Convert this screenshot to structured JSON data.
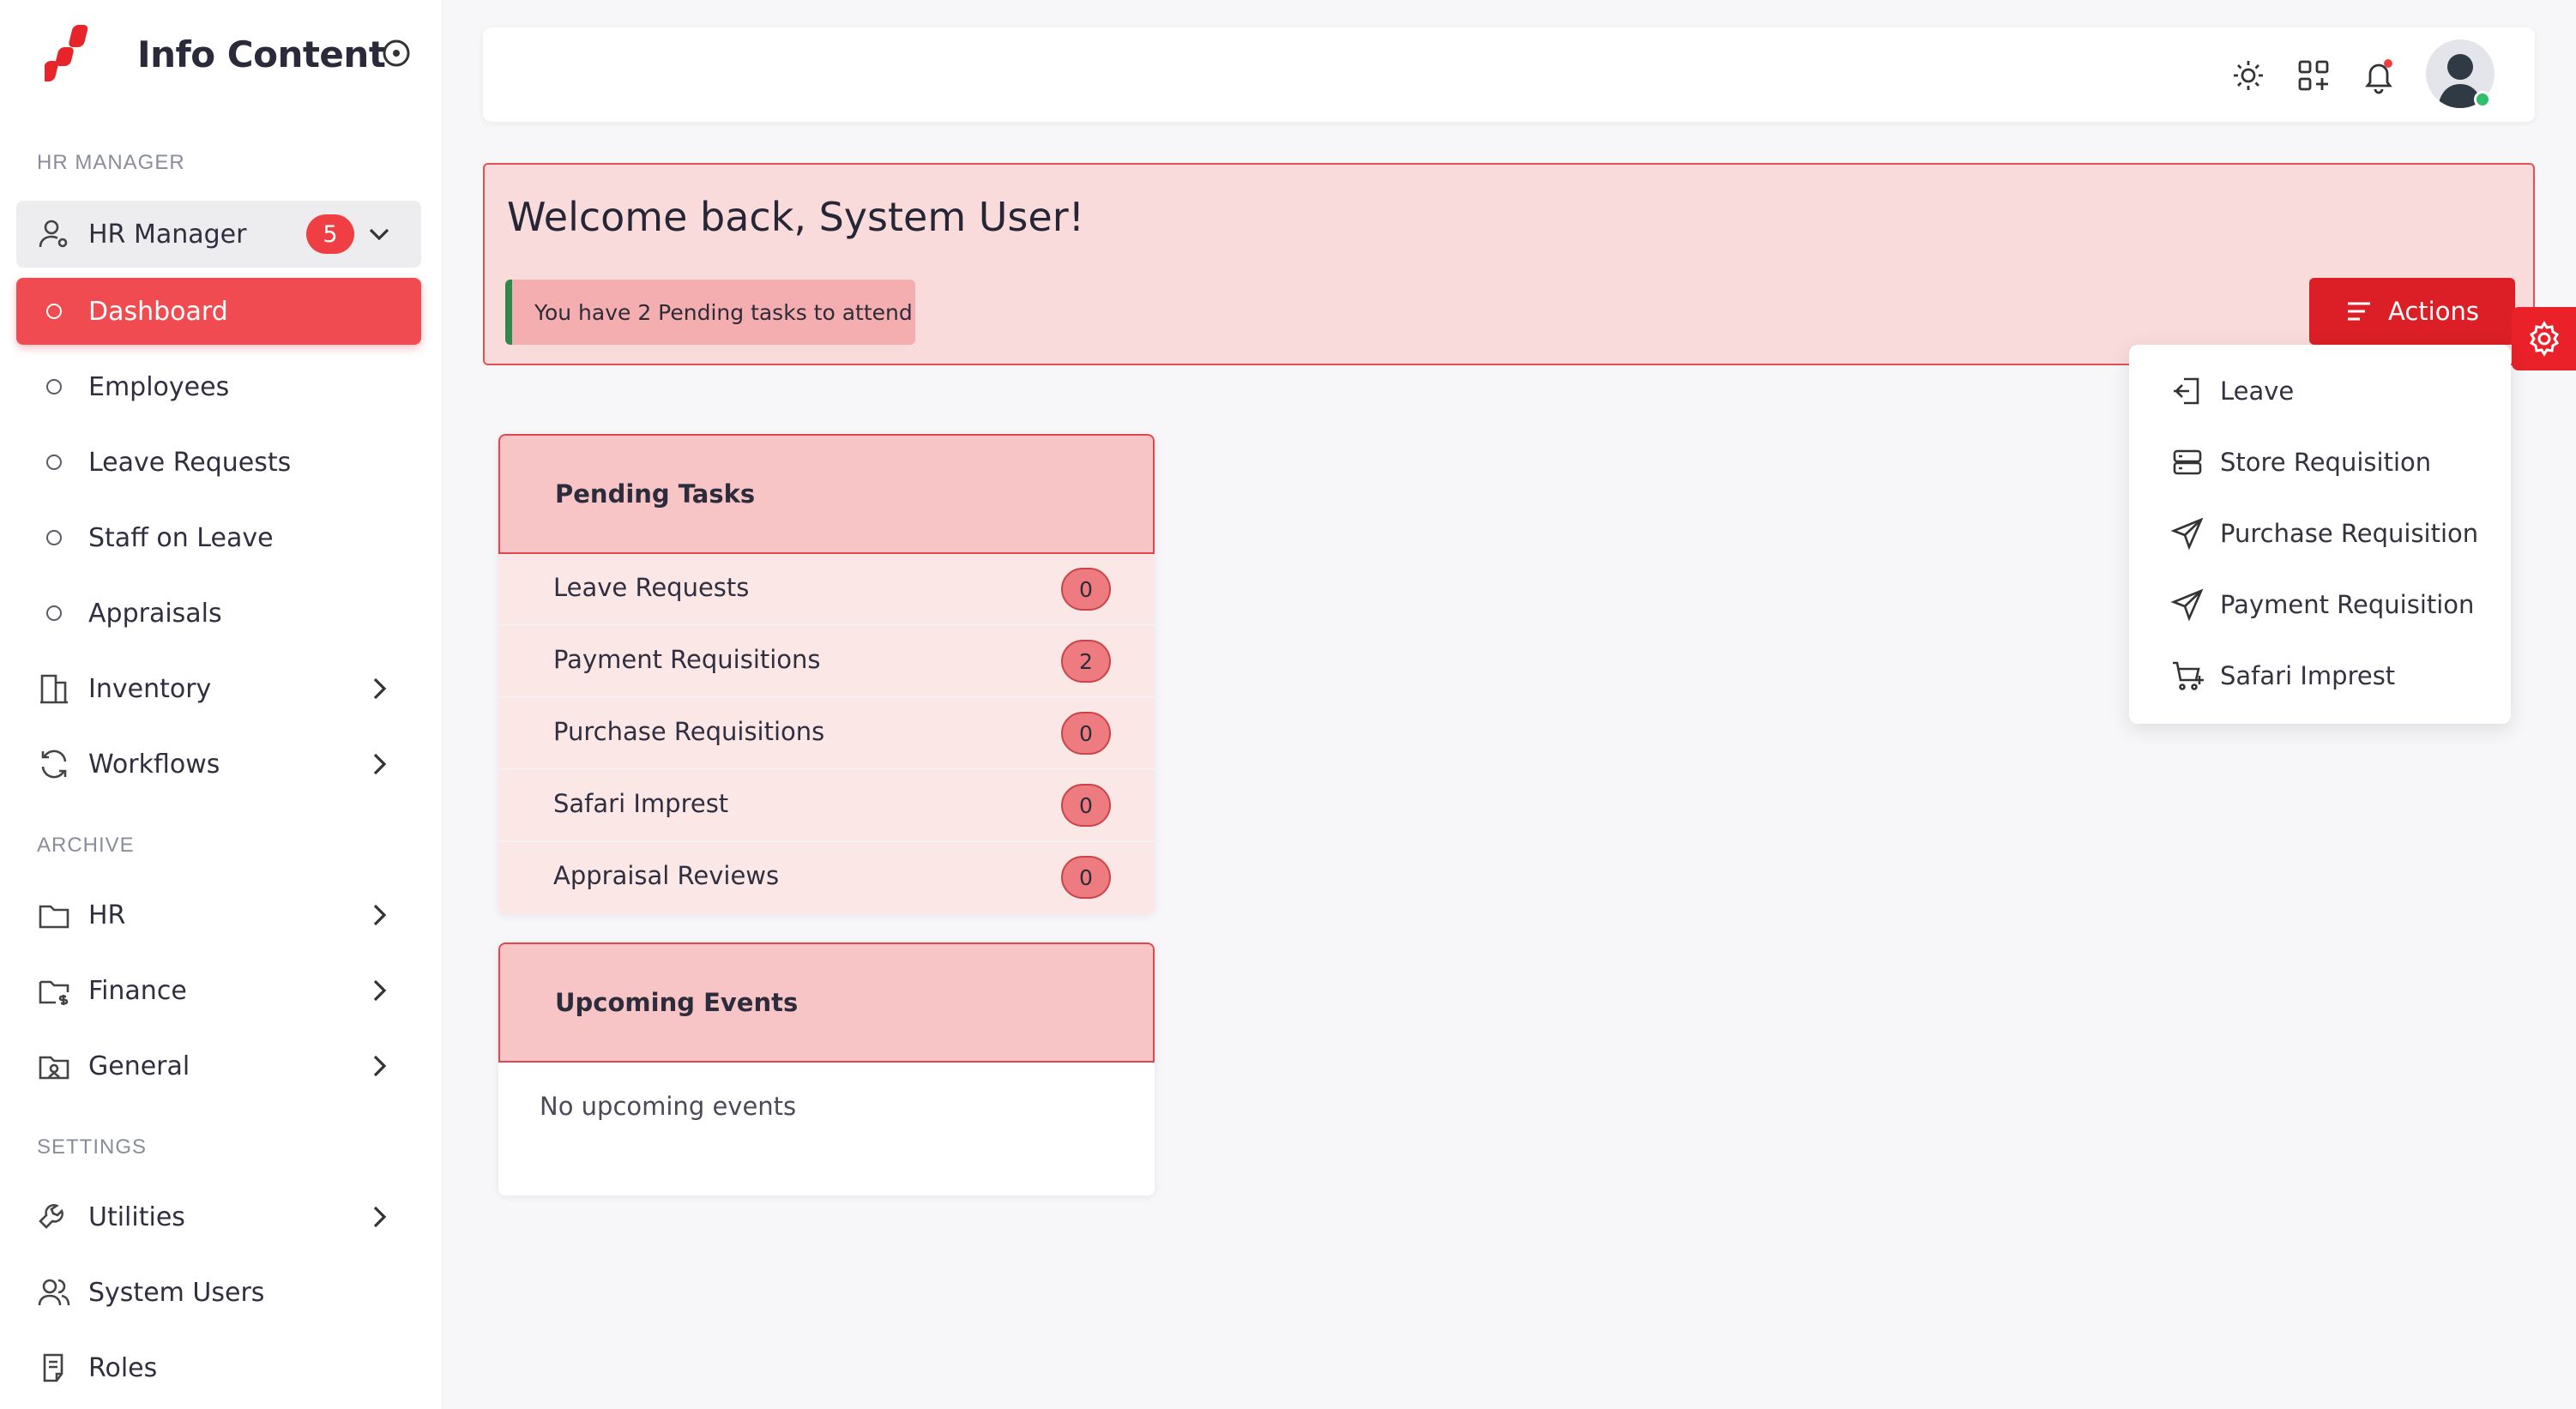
{
  "brand": {
    "title": "Info Content"
  },
  "sidebar": {
    "sections": {
      "hr_manager": "HR MANAGER",
      "archive": "ARCHIVE",
      "settings": "SETTINGS"
    },
    "group": {
      "label": "HR Manager",
      "badge": "5"
    },
    "hr_items": [
      {
        "label": "Dashboard",
        "active": true
      },
      {
        "label": "Employees"
      },
      {
        "label": "Leave Requests"
      },
      {
        "label": "Staff on Leave"
      },
      {
        "label": "Appraisals"
      }
    ],
    "modules": [
      {
        "label": "Inventory",
        "icon": "building-icon"
      },
      {
        "label": "Workflows",
        "icon": "refresh-icon"
      }
    ],
    "archive_items": [
      {
        "label": "HR",
        "icon": "folder-icon"
      },
      {
        "label": "Finance",
        "icon": "folder-dollar-icon"
      },
      {
        "label": "General",
        "icon": "folder-image-icon"
      }
    ],
    "settings_items": [
      {
        "label": "Utilities",
        "icon": "wrench-icon"
      },
      {
        "label": "System Users",
        "icon": "users-icon"
      },
      {
        "label": "Roles",
        "icon": "clipboard-icon"
      }
    ]
  },
  "welcome": {
    "title": "Welcome back, System User!",
    "pending_notice": "You have 2 Pending tasks to attend",
    "actions_label": "Actions"
  },
  "actions_menu": [
    {
      "label": "Leave",
      "icon": "sign-in-icon"
    },
    {
      "label": "Store Requisition",
      "icon": "server-icon"
    },
    {
      "label": "Purchase Requisition",
      "icon": "send-icon"
    },
    {
      "label": "Payment Requisition",
      "icon": "send-icon"
    },
    {
      "label": "Safari Imprest",
      "icon": "cart-plus-icon"
    }
  ],
  "pending_tasks": {
    "title": "Pending Tasks",
    "rows": [
      {
        "label": "Leave Requests",
        "count": "0"
      },
      {
        "label": "Payment Requisitions",
        "count": "2"
      },
      {
        "label": "Purchase Requisitions",
        "count": "0"
      },
      {
        "label": "Safari Imprest",
        "count": "0"
      },
      {
        "label": "Appraisal Reviews",
        "count": "0"
      }
    ]
  },
  "upcoming_events": {
    "title": "Upcoming Events",
    "empty": "No upcoming events"
  },
  "colors": {
    "accent": "#ef4b50",
    "accent_dark": "#dc1f26",
    "banner_bg": "#fadbdb",
    "online": "#2fbf6a"
  }
}
